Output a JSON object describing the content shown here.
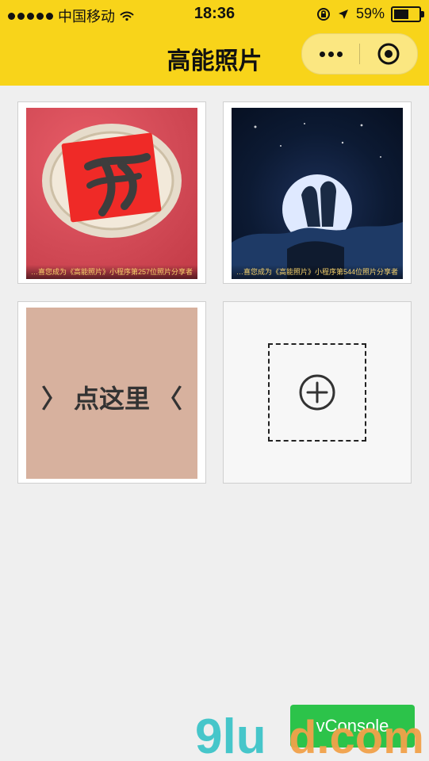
{
  "status_bar": {
    "carrier": "中国移动",
    "time": "18:36",
    "battery": "59%",
    "battery_level": 0.59
  },
  "nav": {
    "title": "高能照片"
  },
  "grid": {
    "tiles": [
      {
        "caption": "…喜您成为《高能照片》小程序第257位照片分享者"
      },
      {
        "caption": "…喜您成为《高能照片》小程序第544位照片分享者"
      },
      {
        "tap_text_left": "〉",
        "tap_text": "点这里",
        "tap_text_right": "〈"
      },
      {
        "add_label": "+"
      }
    ]
  },
  "vconsole_label": "vConsole",
  "watermark": {
    "brand": "9lud.com"
  },
  "colors": {
    "nav": "#f8d41a",
    "page": "#efefef",
    "vconsole": "#2cc34a",
    "tile3": "#d7b19e"
  },
  "icons": [
    "signal-dots-icon",
    "wifi-icon",
    "lock-rotation-icon",
    "location-arrow-icon",
    "battery-icon",
    "more-icon",
    "close-icon",
    "plus-icon"
  ]
}
